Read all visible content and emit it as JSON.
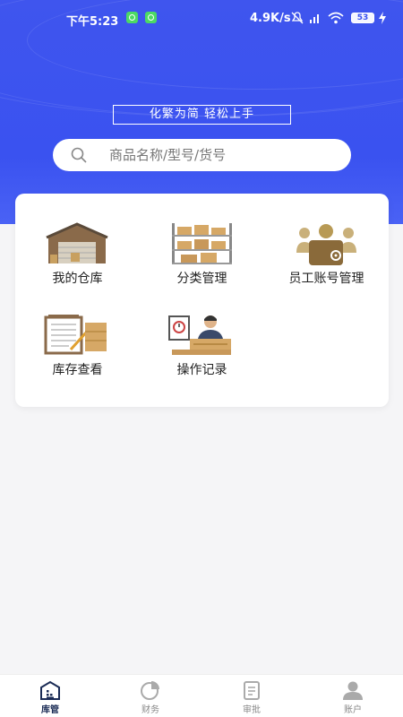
{
  "status_bar": {
    "time": "下午5:23",
    "network_speed": "4.9K/s",
    "battery": "53"
  },
  "header": {
    "slogan": "化繁为简   轻松上手"
  },
  "search": {
    "placeholder": "商品名称/型号/货号"
  },
  "menu": [
    {
      "label": "我的仓库",
      "icon": "warehouse-icon"
    },
    {
      "label": "分类管理",
      "icon": "shelf-boxes-icon"
    },
    {
      "label": "员工账号管理",
      "icon": "staff-account-icon"
    },
    {
      "label": "库存查看",
      "icon": "inventory-clipboard-icon"
    },
    {
      "label": "操作记录",
      "icon": "operator-record-icon"
    }
  ],
  "tabbar": {
    "tabs": [
      {
        "label": "库管",
        "icon": "warehouse-tab-icon",
        "active": true
      },
      {
        "label": "财务",
        "icon": "pie-chart-icon",
        "active": false
      },
      {
        "label": "审批",
        "icon": "clipboard-icon",
        "active": false
      },
      {
        "label": "账户",
        "icon": "user-icon",
        "active": false
      }
    ]
  },
  "colors": {
    "brand_blue": "#3a52f0",
    "tab_active": "#1a2b55"
  }
}
